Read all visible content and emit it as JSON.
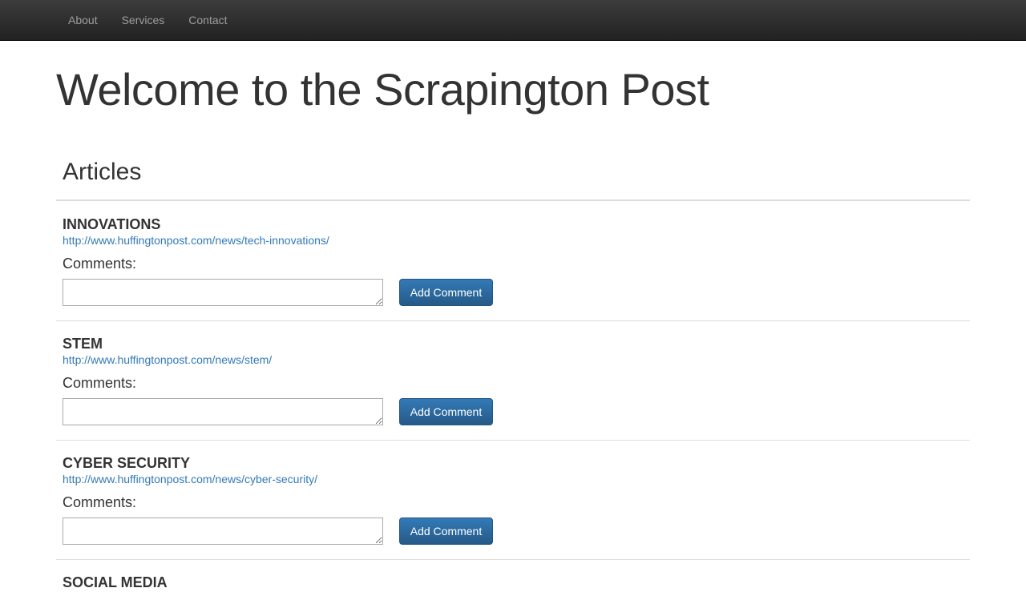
{
  "nav": {
    "items": [
      {
        "label": "About"
      },
      {
        "label": "Services"
      },
      {
        "label": "Contact"
      }
    ]
  },
  "page": {
    "title": "Welcome to the Scrapington Post",
    "section_heading": "Articles"
  },
  "articles": [
    {
      "title": "INNOVATIONS",
      "url": "http://www.huffingtonpost.com/news/tech-innovations/",
      "comments_label": "Comments:",
      "comment_value": "",
      "button_label": "Add Comment"
    },
    {
      "title": "STEM",
      "url": "http://www.huffingtonpost.com/news/stem/",
      "comments_label": "Comments:",
      "comment_value": "",
      "button_label": "Add Comment"
    },
    {
      "title": "CYBER SECURITY",
      "url": "http://www.huffingtonpost.com/news/cyber-security/",
      "comments_label": "Comments:",
      "comment_value": "",
      "button_label": "Add Comment"
    },
    {
      "title": "SOCIAL MEDIA"
    }
  ],
  "colors": {
    "navbar": "#222222",
    "nav_text": "#9d9d9d",
    "link": "#337ab7",
    "button": "#2a6496",
    "text": "#333333"
  }
}
